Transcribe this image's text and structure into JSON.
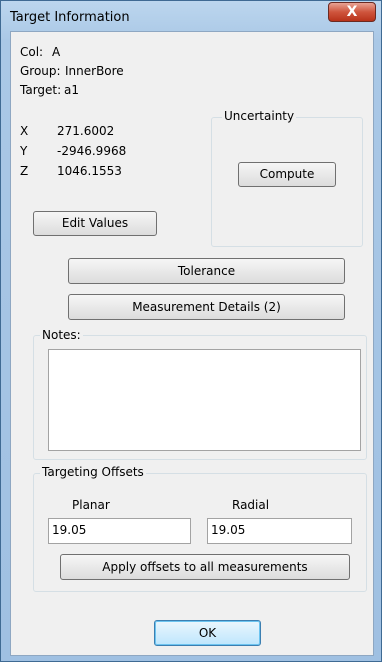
{
  "window": {
    "title": "Target Information",
    "close_glyph": "X"
  },
  "info": {
    "col_label": "Col:",
    "col_value": "A",
    "group_label": "Group:",
    "group_value": "InnerBore",
    "target_label": "Target:",
    "target_value": "a1"
  },
  "coords": {
    "x_label": "X",
    "x_value": "271.6002",
    "y_label": "Y",
    "y_value": "-2946.9968",
    "z_label": "Z",
    "z_value": "1046.1553"
  },
  "uncertainty": {
    "title": "Uncertainty",
    "compute_label": "Compute"
  },
  "buttons": {
    "edit_values": "Edit Values",
    "tolerance": "Tolerance",
    "measurement_details": "Measurement Details (2)",
    "apply_offsets": "Apply offsets to all measurements",
    "ok": "OK"
  },
  "notes": {
    "title": "Notes:",
    "value": ""
  },
  "offsets": {
    "title": "Targeting Offsets",
    "planar_label": "Planar",
    "planar_value": "19.05",
    "radial_label": "Radial",
    "radial_value": "19.05"
  },
  "colors": {
    "titlebar": "#aac8e6",
    "close": "#cf553d",
    "dialog_bg": "#f0f0f0"
  },
  "icons": {
    "close": "close-icon"
  }
}
